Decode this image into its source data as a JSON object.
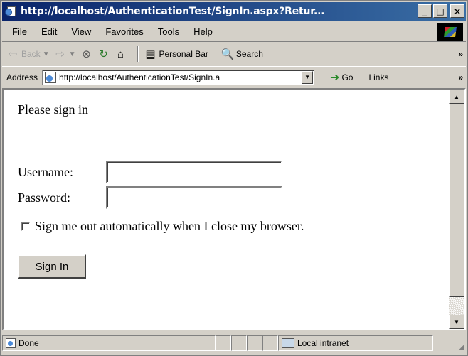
{
  "window": {
    "title": "http://localhost/AuthenticationTest/SignIn.aspx?Retur...",
    "buttons": {
      "minimize": "_",
      "maximize": "□",
      "close": "×"
    }
  },
  "menu": {
    "items": [
      "File",
      "Edit",
      "View",
      "Favorites",
      "Tools",
      "Help"
    ]
  },
  "toolbar": {
    "back_label": "Back",
    "personal_bar_label": "Personal Bar",
    "search_label": "Search",
    "more": "»"
  },
  "address": {
    "label": "Address",
    "url": "http://localhost/AuthenticationTest/SignIn.a",
    "go_label": "Go",
    "links_label": "Links",
    "more": "»"
  },
  "page": {
    "prompt": "Please sign in",
    "username_label": "Username:",
    "username_value": "",
    "password_label": "Password:",
    "password_value": "",
    "remember_label": "Sign me out automatically when I close my browser.",
    "remember_checked": false,
    "submit_label": "Sign In"
  },
  "status": {
    "text": "Done",
    "zone": "Local intranet"
  },
  "colors": {
    "titlebar": "#0a246a",
    "chrome": "#d4d0c8"
  }
}
